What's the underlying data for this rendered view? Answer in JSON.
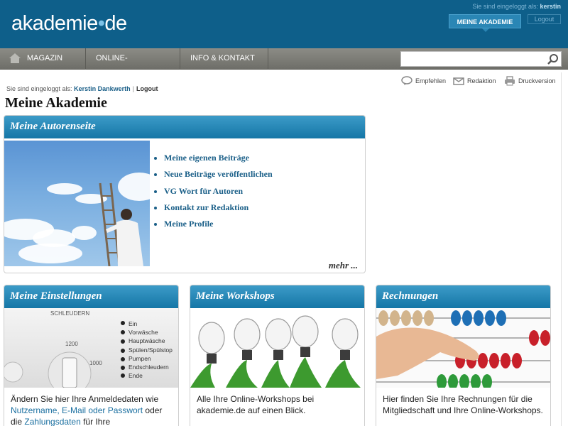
{
  "header": {
    "logo_main": "akademie",
    "logo_dot": "•",
    "logo_tld": "de",
    "login_prefix": "Sie sind eingeloggt als:",
    "login_user": "kerstin",
    "meine_akademie_label": "MEINE AKADEMIE",
    "logout_label": "Logout"
  },
  "nav": {
    "items": [
      {
        "label": "MAGAZIN",
        "icon": "home-icon"
      },
      {
        "label": "ONLINE-WORKSHOPS"
      },
      {
        "label": "INFO & KONTAKT"
      }
    ],
    "search_placeholder": "",
    "search_value": ""
  },
  "tools": {
    "empfehlen": "Empfehlen",
    "redaktion": "Redaktion",
    "druckversion": "Druckversion"
  },
  "session": {
    "prefix": "Sie sind eingeloggt als:",
    "name": "Kerstin Dankwerth",
    "separator": "|",
    "logout": "Logout"
  },
  "page_title": "Meine Akademie",
  "autorenseite": {
    "title": "Meine Autorenseite",
    "links": [
      "Meine eigenen Beiträge",
      "Neue Beiträge veröffentlichen",
      "VG Wort für Autoren",
      "Kontakt zur Redaktion",
      "Meine Profile"
    ],
    "more": "mehr ..."
  },
  "einstellungen": {
    "title": "Meine Einstellungen",
    "dial_header": "SCHLEUDERN",
    "dial_num1": "1200",
    "dial_num2": "1000",
    "dial_options": [
      "Ein",
      "Vorwäsche",
      "Hauptwäsche",
      "Spülen/Spülstop",
      "Pumpen",
      "Endschleudern",
      "Ende"
    ],
    "desc_1": "Ändern Sie hier Ihre Anmeldedaten wie ",
    "link_1": "Nutzername, E-Mail oder Passwort",
    "desc_2": " oder die ",
    "link_2": "Zahlungsdaten",
    "desc_3": " für Ihre"
  },
  "workshops": {
    "title": "Meine Workshops",
    "desc": "Alle Ihre Online-Workshops bei akademie.de auf einen Blick."
  },
  "rechnungen": {
    "title": "Rechnungen",
    "desc": "Hier finden Sie Ihre Rechnungen für die Mitgliedschaft und Ihre Online-Workshops."
  },
  "colors": {
    "header_blue": "#0e5f8a",
    "box_head_blue": "#1576a6",
    "link_blue": "#1a5f88",
    "nav_gray": "#7d7d78"
  }
}
